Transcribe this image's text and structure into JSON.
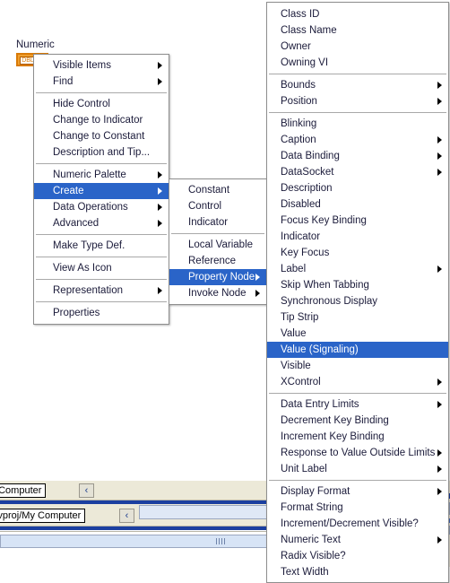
{
  "front_panel": {
    "control": {
      "label": "Numeric",
      "terminal_text": "DBL",
      "terminal_color": "#f0a030"
    }
  },
  "theme": {
    "menu_bg": "#ffffff",
    "menu_border": "#8e8e8e",
    "highlight_bg": "#2a64c8",
    "highlight_fg": "#ffffff",
    "text": "#1b1b3a",
    "separator": "#a9a9a9"
  },
  "context_menu": {
    "name": "control-context-menu",
    "items": [
      {
        "label": "Visible Items",
        "submenu": true
      },
      {
        "label": "Find",
        "submenu": true
      },
      {
        "separator": true
      },
      {
        "label": "Hide Control"
      },
      {
        "label": "Change to Indicator"
      },
      {
        "label": "Change to Constant"
      },
      {
        "label": "Description and Tip..."
      },
      {
        "separator": true
      },
      {
        "label": "Numeric Palette",
        "submenu": true
      },
      {
        "label": "Create",
        "submenu": true,
        "selected": true
      },
      {
        "label": "Data Operations",
        "submenu": true
      },
      {
        "label": "Advanced",
        "submenu": true
      },
      {
        "separator": true
      },
      {
        "label": "Make Type Def."
      },
      {
        "separator": true
      },
      {
        "label": "View As Icon"
      },
      {
        "separator": true
      },
      {
        "label": "Representation",
        "submenu": true
      },
      {
        "separator": true
      },
      {
        "label": "Properties"
      }
    ]
  },
  "create_menu": {
    "name": "create-submenu",
    "items": [
      {
        "label": "Constant"
      },
      {
        "label": "Control"
      },
      {
        "label": "Indicator"
      },
      {
        "separator": true
      },
      {
        "label": "Local Variable"
      },
      {
        "label": "Reference"
      },
      {
        "label": "Property Node",
        "submenu": true,
        "selected": true
      },
      {
        "label": "Invoke Node",
        "submenu": true
      }
    ]
  },
  "property_node_menu": {
    "name": "property-node-submenu",
    "items": [
      {
        "label": "Class ID"
      },
      {
        "label": "Class Name"
      },
      {
        "label": "Owner"
      },
      {
        "label": "Owning VI"
      },
      {
        "separator": true
      },
      {
        "label": "Bounds",
        "submenu": true
      },
      {
        "label": "Position",
        "submenu": true
      },
      {
        "separator": true
      },
      {
        "label": "Blinking"
      },
      {
        "label": "Caption",
        "submenu": true
      },
      {
        "label": "Data Binding",
        "submenu": true
      },
      {
        "label": "DataSocket",
        "submenu": true
      },
      {
        "label": "Description"
      },
      {
        "label": "Disabled"
      },
      {
        "label": "Focus Key Binding"
      },
      {
        "label": "Indicator"
      },
      {
        "label": "Key Focus"
      },
      {
        "label": "Label",
        "submenu": true
      },
      {
        "label": "Skip When Tabbing"
      },
      {
        "label": "Synchronous Display"
      },
      {
        "label": "Tip Strip"
      },
      {
        "label": "Value"
      },
      {
        "label": "Value (Signaling)",
        "selected": true
      },
      {
        "label": "Visible"
      },
      {
        "label": "XControl",
        "submenu": true
      },
      {
        "separator": true
      },
      {
        "label": "Data Entry Limits",
        "submenu": true
      },
      {
        "label": "Decrement Key Binding"
      },
      {
        "label": "Increment Key Binding"
      },
      {
        "label": "Response to Value Outside Limits",
        "submenu": true
      },
      {
        "label": "Unit Label",
        "submenu": true
      },
      {
        "separator": true
      },
      {
        "label": "Display Format",
        "submenu": true
      },
      {
        "label": "Format String"
      },
      {
        "label": "Increment/Decrement Visible?"
      },
      {
        "label": "Numeric Text",
        "submenu": true
      },
      {
        "label": "Radix Visible?"
      },
      {
        "label": "Text Width"
      }
    ]
  },
  "background_windows": {
    "top_window": {
      "path_text": "proj/My Computer",
      "back_button": "‹"
    },
    "bottom_window": {
      "path_text": "roject.lvproj/My Computer",
      "back_button": "‹"
    }
  }
}
